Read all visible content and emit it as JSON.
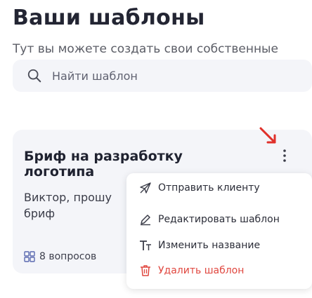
{
  "page": {
    "title": "Ваши шаблоны",
    "subtitle": "Тут вы можете создать свои собственные"
  },
  "search": {
    "placeholder": "Найти шаблон"
  },
  "card": {
    "title": "Бриф на разработку логотипа",
    "description": "Виктор, прошу бриф",
    "question_count": "8 вопросов"
  },
  "menu": {
    "send": "Отправить клиенту",
    "edit": "Редактировать шаблон",
    "rename": "Изменить название",
    "delete": "Удалить шаблон"
  },
  "colors": {
    "accent_arrow": "#e0302a",
    "danger": "#e0473f"
  }
}
